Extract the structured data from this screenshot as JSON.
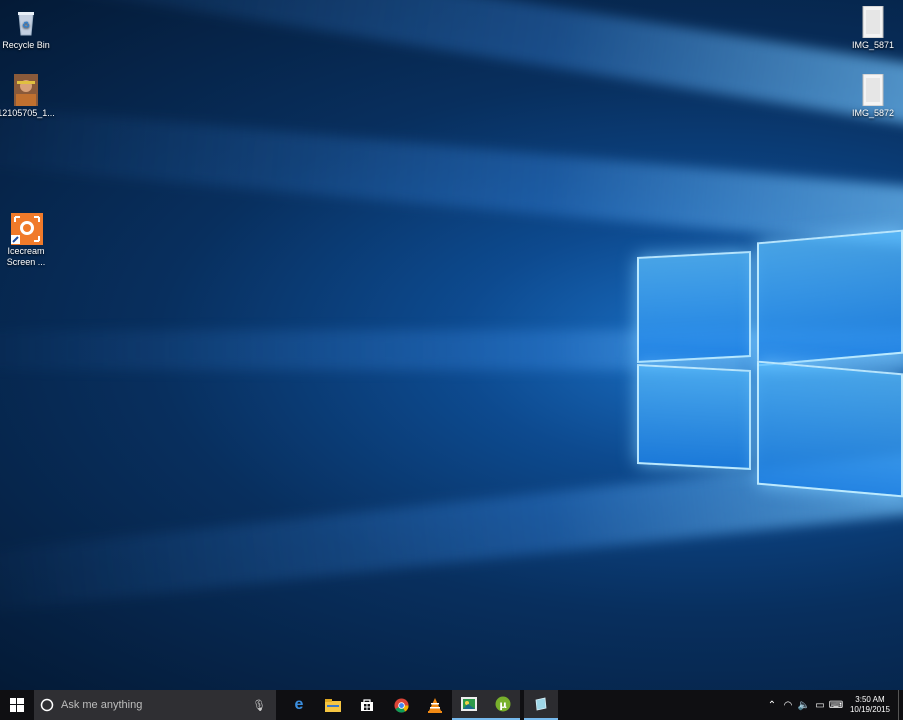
{
  "desktop": {
    "icons": [
      {
        "label": "Recycle Bin",
        "icon": "recycle-bin-icon"
      },
      {
        "label": "12105705_1...",
        "icon": "photo-thumbnail-icon"
      },
      {
        "label": "Icecream Screen ...",
        "icon": "icecream-screen-recorder-icon"
      },
      {
        "label": "IMG_5871",
        "icon": "image-file-icon"
      },
      {
        "label": "IMG_5872",
        "icon": "image-file-icon"
      }
    ]
  },
  "taskbar": {
    "search_placeholder": "Ask me anything",
    "pinned": [
      "start-button",
      "cortana-icon",
      "edge-icon",
      "file-explorer-icon",
      "store-icon",
      "chrome-icon",
      "vlc-icon",
      "photos-icon",
      "utorrent-icon",
      "notes-icon"
    ],
    "tray": {
      "time": "3:50 AM",
      "date": "10/19/2015"
    }
  },
  "colors": {
    "taskbar_bg": "#0f0f12",
    "search_bg": "#2f2f33",
    "accent": "#76b9ed",
    "desktop_glow": "#5abeff"
  }
}
